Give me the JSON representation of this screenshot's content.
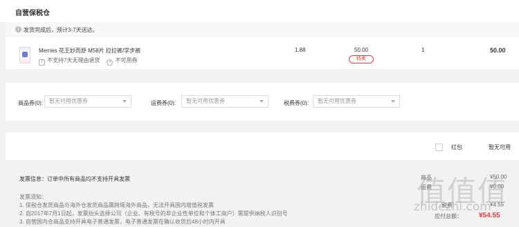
{
  "section": {
    "title": "自营保税仓"
  },
  "shipping": {
    "icon": "info-icon",
    "text": "发货完成后，预计3-7天送达。"
  },
  "product": {
    "name": "Merries 花王妙而舒 M58片 拉拉裤/学步裤",
    "tag1": "不支持7天无理由退货",
    "tag2": "不可用券",
    "price": "1.88",
    "tax_or_unit": "50.00",
    "badge": "特卖",
    "qty": "1",
    "total": "50.00"
  },
  "coupons": {
    "goods_label": "商品券(0):",
    "goods_value": "暂无可用优惠券",
    "freight_label": "运费券(0):",
    "freight_value": "暂无可用优惠券",
    "tax_label": "税费券(0):",
    "tax_value": "暂无可用优惠券"
  },
  "redpack": {
    "label": "红包",
    "status": "暂无可用"
  },
  "invoice": {
    "info": "发票信息：订单中所有商品均不支持开具发票",
    "notice_title": "发票须知：",
    "notice_lines": [
      "1. 保税仓发货商品与海外仓发货商品属跨境海外商品，无法开具国内增值税发票",
      "2. 自2017年7月1日起，发票抬头选择公司（企业、有税号的非企业性单位和个体工商户）需提供纳税人识别号",
      "3. 自营国内仓商品支持开具电子普通发票，电子普通发票在确认收货后48小时内开具"
    ]
  },
  "summary": {
    "rows": [
      {
        "label": "商品",
        "value": "¥50.00"
      },
      {
        "label": "运费",
        "value": "¥0.00"
      },
      {
        "label": "税费",
        "value": "¥4.55"
      }
    ],
    "total_label": "应付总额：",
    "total_value": "¥54.55"
  },
  "watermark": {
    "logo": "值值值",
    "url": "zhidezhi.com"
  }
}
